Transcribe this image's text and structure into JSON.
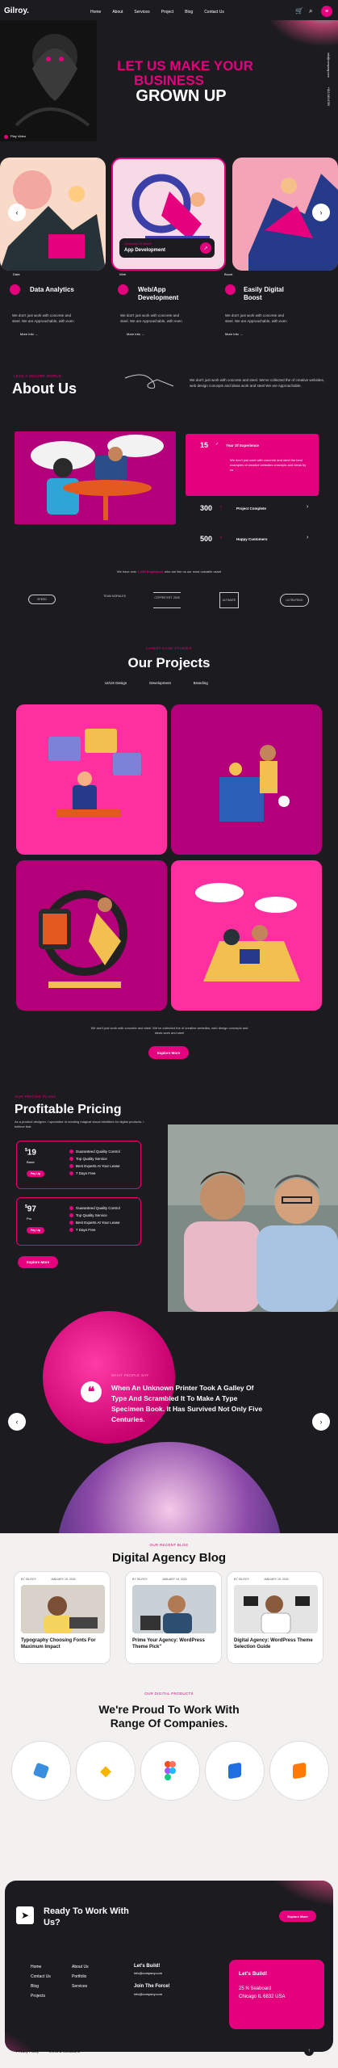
{
  "header": {
    "logo": "Gilroy.",
    "nav": [
      "Home",
      "About",
      "Services",
      "Project",
      "Blog",
      "Contact Us"
    ]
  },
  "hero": {
    "line1": "LET US MAKE YOUR",
    "line2": "BUSINESS",
    "line3": "GROWN UP",
    "play_label": "Play Video",
    "side_text_1": "info@company.com",
    "side_text_2": "+012 345 6789"
  },
  "services": {
    "slide_label": "Generation Of Wealth",
    "slide_title": "App Development",
    "captions": [
      "Data",
      "Web",
      "Boost"
    ],
    "items": [
      {
        "title": "Data Analytics",
        "desc": "We don't just work with concrete and steel. We are Approachable, with even"
      },
      {
        "title": "Web/App Development",
        "desc": "We don't just work with concrete and steel. We are Approachable, with even"
      },
      {
        "title": "Easily Digital Boost",
        "desc": "We don't just work with concrete and steel. We are Approachable, with even"
      }
    ],
    "more": "More Info"
  },
  "about": {
    "tag": "LEAD A SECURE WORLD",
    "title": "About Us",
    "desc": "We don't just work with concrete and steel. We've collected the of creative websites, web design concepts and ideas work and steel We are Approachable,",
    "stats": [
      {
        "value": "15",
        "label": "Year Of Experience",
        "desc": "We don't just work with concrete and steel the best examples of creative websites concepts and ideas by us"
      },
      {
        "value": "300",
        "label": "Project Complete"
      },
      {
        "value": "500",
        "label": "Happy Customers"
      }
    ],
    "employees_pre": "We have over",
    "employees_bold": "1,205 Employees",
    "employees_post": "who are like us our most valuable asset",
    "brands": [
      "SPEED",
      "TEAM MORALES",
      "COFFEE EST. 2005",
      "ULTIMATE",
      "ULTRA PACK"
    ]
  },
  "projects": {
    "tag": "LATEST CASE STUDIES",
    "title": "Our Projects",
    "filters": [
      "UI/UX Design",
      "Development",
      "Branding"
    ],
    "desc": "We don't just work with concrete and steel. We've collected the of creative websites, web design concepts and ideas work and steel",
    "explore": "Explore More"
  },
  "pricing": {
    "tag": "OUR PRICING PLANS",
    "title": "Profitable Pricing",
    "desc": "As a product designer, I specialize in creating magical visual identities for digital products. I believe that",
    "plans": [
      {
        "price": "19",
        "name": "Basic",
        "btn": "Pay Up",
        "features": [
          "Guaranteed Quality Control",
          "Top Quality Service",
          "Best Experts At Your Lease",
          "7 Days Free"
        ]
      },
      {
        "price": "97",
        "name": "Pro",
        "btn": "Pay Up",
        "features": [
          "Guaranteed Quality Control",
          "Top Quality Service",
          "Best Experts At Your Lease",
          "7 Days Free"
        ]
      }
    ],
    "explore": "Explore More"
  },
  "testimonial": {
    "tag": "WHAT PEOPLE SAY",
    "quote": "When An Unknown Printer Took A Galley Of Type And Scrambled It To Make A Type Specimen Book. It Has Survived Not Only Five Centuries."
  },
  "blog": {
    "tag": "OUR RECENT BLOG",
    "title": "Digital Agency Blog",
    "posts": [
      {
        "author": "BY GILROY",
        "date": "JANUARY 19, 2024",
        "title": "Typography Choosing Fonts For Maximum Impact"
      },
      {
        "author": "BY GILROY",
        "date": "JANUARY 19, 2024",
        "title": "Prime Your Agency: WordPress Theme Pick\""
      },
      {
        "author": "BY GILROY",
        "date": "JANUARY 19, 2024",
        "title": "Digital Agency: WordPress Theme Selection Guide"
      }
    ]
  },
  "partners": {
    "tag": "OUR DIGITAL PRODUCTS",
    "title_1": "We're Proud To Work With",
    "title_2": "Range Of Companies."
  },
  "footer": {
    "cta": "Ready To Work With Us?",
    "cta_btn": "Explore More",
    "col1": [
      "Home",
      "Contact Us",
      "Blog",
      "Projects"
    ],
    "col2": [
      "About Us",
      "Portfolio",
      "Services"
    ],
    "lets_build": "Let's Build!",
    "email": "info@company.com",
    "join": "Join The Force!",
    "email2": "info@company.com",
    "card_title": "Let's Build!",
    "address_1": "25 N Seaboard",
    "address_2": "Chicago IL 6832 USA",
    "bottom_links": [
      "Privacy Policy",
      "Terms & Conditions"
    ]
  },
  "colors": {
    "accent": "#e5007e",
    "bg": "#1c1b1f",
    "light_bg": "#f2f1ef"
  }
}
